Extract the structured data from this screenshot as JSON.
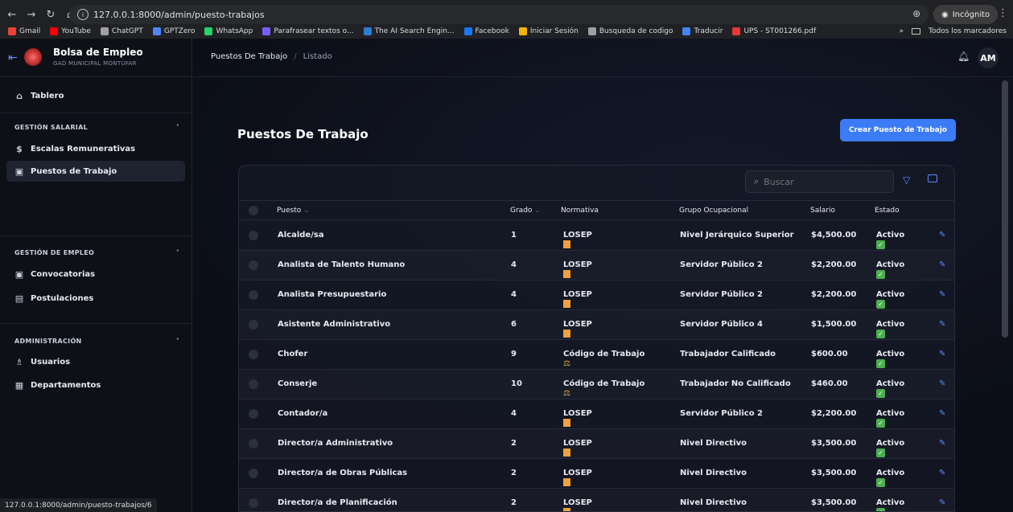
{
  "browser": {
    "url": "127.0.0.1:8000/admin/puesto-trabajos",
    "incognito_label": "Incógnito",
    "bookmarks": [
      {
        "label": "Gmail",
        "color": "#ea4335"
      },
      {
        "label": "YouTube",
        "color": "#ff0000"
      },
      {
        "label": "ChatGPT",
        "color": "#a0a0a0"
      },
      {
        "label": "GPTZero",
        "color": "#4f86f7"
      },
      {
        "label": "WhatsApp",
        "color": "#25d366"
      },
      {
        "label": "Parafrasear textos o...",
        "color": "#7b5cff"
      },
      {
        "label": "The AI Search Engin...",
        "color": "#2d7dd2"
      },
      {
        "label": "Facebook",
        "color": "#1877f2"
      },
      {
        "label": "Iniciar Sesión",
        "color": "#f2b400"
      },
      {
        "label": "Busqueda de codigo",
        "color": "#9aa0a6"
      },
      {
        "label": "Traducir",
        "color": "#4285f4"
      },
      {
        "label": "UPS - ST001266.pdf",
        "color": "#e53935"
      }
    ],
    "more_label": "»",
    "all_bookmarks_label": "Todos los marcadores",
    "status_url": "127.0.0.1:8000/admin/puesto-trabajos/6"
  },
  "brand": {
    "title": "Bolsa de Empleo",
    "subtitle": "GAD MUNICIPAL MONTÚFAR"
  },
  "sidebar": {
    "dashboard": "Tablero",
    "sections": [
      {
        "title": "GESTIÓN SALARIAL",
        "items": [
          "Escalas Remunerativas",
          "Puestos de Trabajo"
        ]
      },
      {
        "title": "GESTIÓN DE EMPLEO",
        "items": [
          "Convocatorias",
          "Postulaciones"
        ]
      },
      {
        "title": "ADMINISTRACIÓN",
        "items": [
          "Usuarios",
          "Departamentos"
        ]
      }
    ]
  },
  "topbar": {
    "crumb_1": "Puestos De Trabajo",
    "crumb_2": "Listado",
    "avatar": "AM"
  },
  "page": {
    "title": "Puestos De Trabajo",
    "create_label": "Crear Puesto de Trabajo",
    "search_placeholder": "Buscar"
  },
  "table": {
    "headers": [
      "Puesto",
      "Grado",
      "Normativa",
      "Grupo Ocupacional",
      "Salario",
      "Estado"
    ],
    "rows": [
      {
        "puesto": "Alcalde/sa",
        "grado": "1",
        "normativa": "LOSEP",
        "grupo": "Nivel Jerárquico Superior",
        "salario": "$4,500.00",
        "estado": "Activo"
      },
      {
        "puesto": "Analista de Talento Humano",
        "grado": "4",
        "normativa": "LOSEP",
        "grupo": "Servidor Público 2",
        "salario": "$2,200.00",
        "estado": "Activo"
      },
      {
        "puesto": "Analista Presupuestario",
        "grado": "4",
        "normativa": "LOSEP",
        "grupo": "Servidor Público 2",
        "salario": "$2,200.00",
        "estado": "Activo"
      },
      {
        "puesto": "Asistente Administrativo",
        "grado": "6",
        "normativa": "LOSEP",
        "grupo": "Servidor Público 4",
        "salario": "$1,500.00",
        "estado": "Activo"
      },
      {
        "puesto": "Chofer",
        "grado": "9",
        "normativa": "Código de Trabajo",
        "grupo": "Trabajador Calificado",
        "salario": "$600.00",
        "estado": "Activo"
      },
      {
        "puesto": "Conserje",
        "grado": "10",
        "normativa": "Código de Trabajo",
        "grupo": "Trabajador No Calificado",
        "salario": "$460.00",
        "estado": "Activo"
      },
      {
        "puesto": "Contador/a",
        "grado": "4",
        "normativa": "LOSEP",
        "grupo": "Servidor Público 2",
        "salario": "$2,200.00",
        "estado": "Activo"
      },
      {
        "puesto": "Director/a Administrativo",
        "grado": "2",
        "normativa": "LOSEP",
        "grupo": "Nivel Directivo",
        "salario": "$3,500.00",
        "estado": "Activo"
      },
      {
        "puesto": "Director/a de Obras Públicas",
        "grado": "2",
        "normativa": "LOSEP",
        "grupo": "Nivel Directivo",
        "salario": "$3,500.00",
        "estado": "Activo"
      },
      {
        "puesto": "Director/a de Planificación",
        "grado": "2",
        "normativa": "LOSEP",
        "grupo": "Nivel Directivo",
        "salario": "$3,500.00",
        "estado": "Activo"
      }
    ]
  }
}
